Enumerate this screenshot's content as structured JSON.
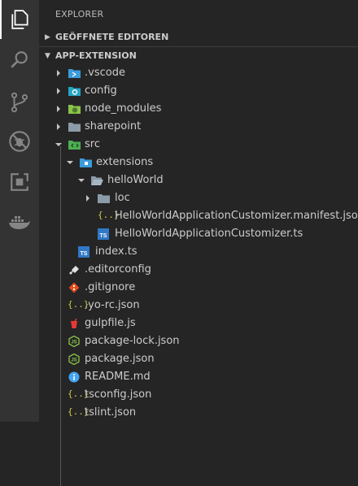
{
  "explorer_title": "EXPLORER",
  "sections": {
    "open_editors": "GEÖFFNETE EDITOREN",
    "project": "APP-EXTENSION"
  },
  "activity_bar": [
    {
      "name": "explorer-icon",
      "active": true
    },
    {
      "name": "search-icon",
      "active": false
    },
    {
      "name": "source-control-icon",
      "active": false
    },
    {
      "name": "debug-icon",
      "active": false
    },
    {
      "name": "extensions-icon",
      "active": false
    },
    {
      "name": "docker-icon",
      "active": false
    }
  ],
  "tree": [
    {
      "label": ".vscode",
      "kind": "folder",
      "expanded": false,
      "icon": "vscode-folder-icon",
      "color": "#3b9bdb"
    },
    {
      "label": "config",
      "kind": "folder",
      "expanded": false,
      "icon": "config-folder-icon",
      "color": "#26a5c4"
    },
    {
      "label": "node_modules",
      "kind": "folder",
      "expanded": false,
      "icon": "node-folder-icon",
      "color": "#8bc34a"
    },
    {
      "label": "sharepoint",
      "kind": "folder",
      "expanded": false,
      "icon": "folder-icon",
      "color": "#8d9ba8"
    },
    {
      "label": "src",
      "kind": "folder",
      "expanded": true,
      "icon": "src-folder-icon",
      "color": "#4caf50"
    },
    {
      "label": "extensions",
      "kind": "folder",
      "expanded": true,
      "icon": "extensions-folder-icon",
      "color": "#3b9bdb"
    },
    {
      "label": "helloWorld",
      "kind": "folder",
      "expanded": true,
      "icon": "folder-open-icon",
      "color": "#8d9ba8"
    },
    {
      "label": "loc",
      "kind": "folder",
      "expanded": false,
      "icon": "folder-icon",
      "color": "#8d9ba8"
    },
    {
      "label": "HelloWorldApplicationCustomizer.manifest.json",
      "kind": "file",
      "icon": "json-icon",
      "color": "#cbcb41"
    },
    {
      "label": "HelloWorldApplicationCustomizer.ts",
      "kind": "file",
      "icon": "typescript-icon",
      "color": "#3178c6"
    },
    {
      "label": "index.ts",
      "kind": "file",
      "icon": "typescript-icon",
      "color": "#3178c6"
    },
    {
      "label": ".editorconfig",
      "kind": "file",
      "icon": "editorconfig-icon",
      "color": "#e0e0e0"
    },
    {
      "label": ".gitignore",
      "kind": "file",
      "icon": "git-icon",
      "color": "#e64a19"
    },
    {
      "label": ".yo-rc.json",
      "kind": "file",
      "icon": "json-icon",
      "color": "#cbcb41"
    },
    {
      "label": "gulpfile.js",
      "kind": "file",
      "icon": "gulp-icon",
      "color": "#e53935"
    },
    {
      "label": "package-lock.json",
      "kind": "file",
      "icon": "npm-icon",
      "color": "#8bc34a"
    },
    {
      "label": "package.json",
      "kind": "file",
      "icon": "npm-icon",
      "color": "#8bc34a"
    },
    {
      "label": "README.md",
      "kind": "file",
      "icon": "info-icon",
      "color": "#42a5f5"
    },
    {
      "label": "tsconfig.json",
      "kind": "file",
      "icon": "json-icon",
      "color": "#cbcb41"
    },
    {
      "label": "tslint.json",
      "kind": "file",
      "icon": "json-icon",
      "color": "#cbcb41"
    }
  ]
}
